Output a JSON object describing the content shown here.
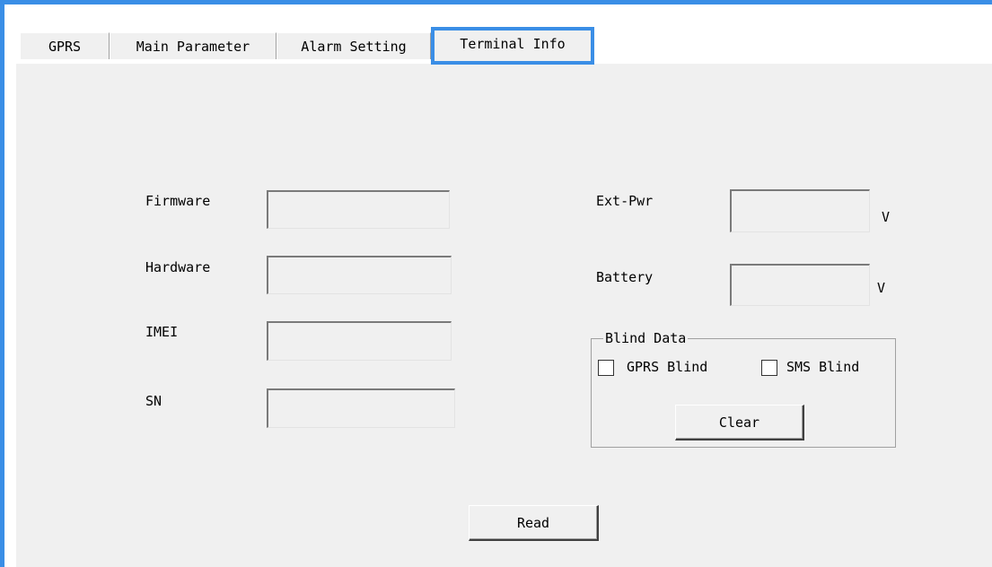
{
  "tabs": [
    {
      "label": "GPRS"
    },
    {
      "label": "Main Parameter"
    },
    {
      "label": "Alarm Setting"
    },
    {
      "label": "Terminal Info"
    }
  ],
  "active_tab": 3,
  "left_fields": [
    {
      "label": "Firmware",
      "value": ""
    },
    {
      "label": "Hardware",
      "value": ""
    },
    {
      "label": "IMEI",
      "value": ""
    },
    {
      "label": "SN",
      "value": ""
    }
  ],
  "right_fields": [
    {
      "label": "Ext-Pwr",
      "value": "",
      "unit": "V"
    },
    {
      "label": "Battery",
      "value": "",
      "unit": "V"
    }
  ],
  "blind_data": {
    "title": "Blind Data",
    "gprs_blind_label": "GPRS Blind",
    "gprs_blind_checked": false,
    "sms_blind_label": "SMS Blind",
    "sms_blind_checked": false,
    "clear_label": "Clear"
  },
  "read_label": "Read",
  "colors": {
    "accent": "#3a8ee6",
    "panel_bg": "#f0f0f0"
  }
}
